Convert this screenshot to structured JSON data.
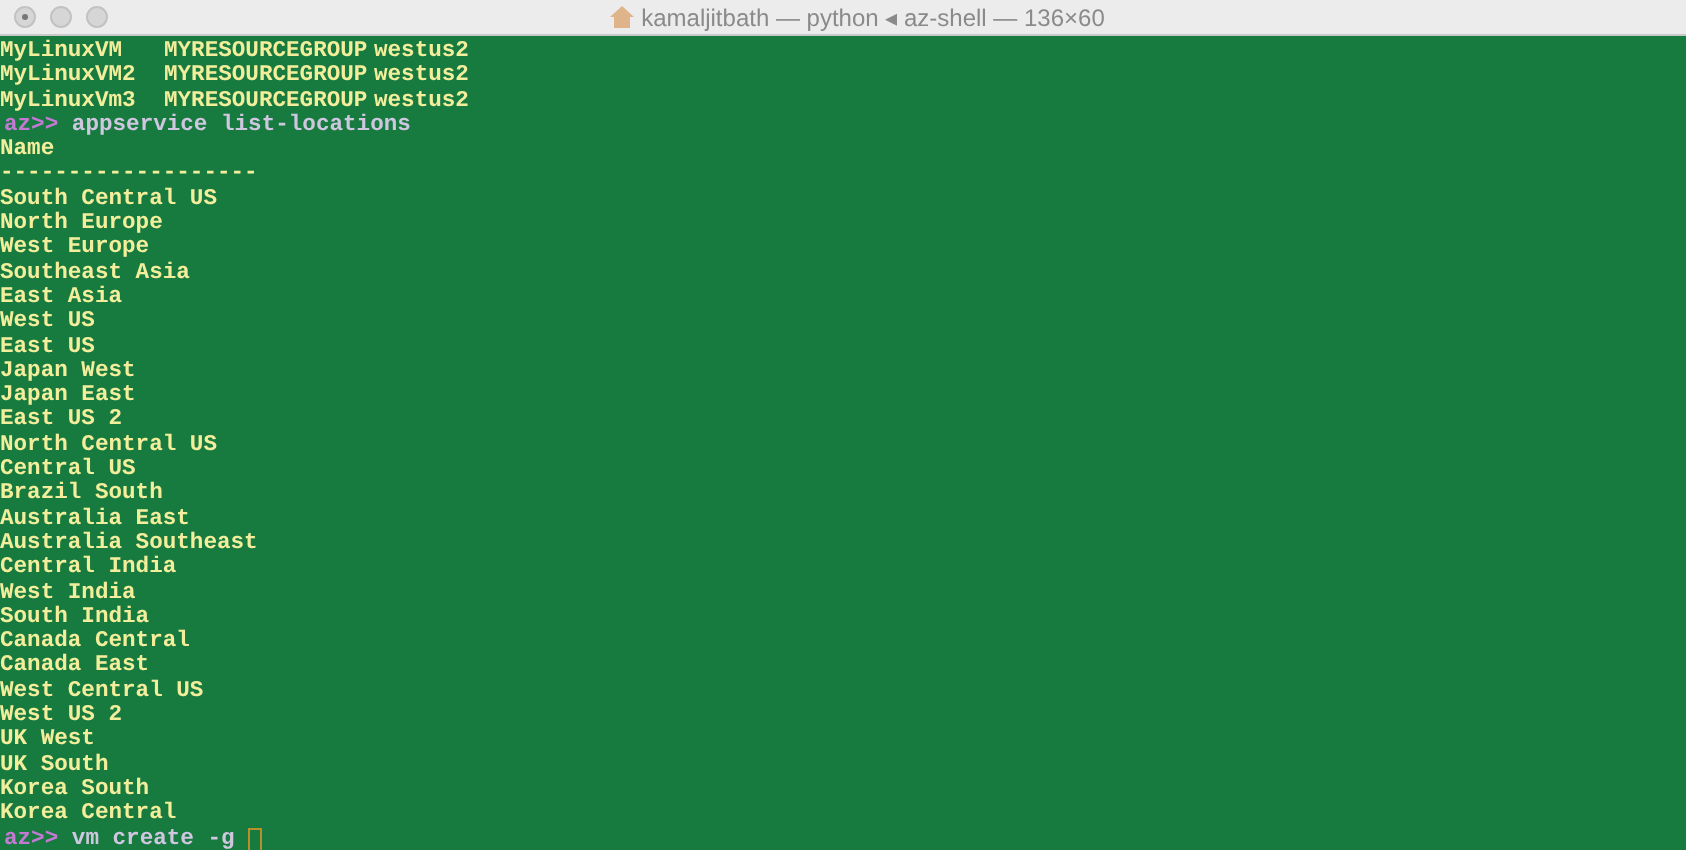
{
  "window": {
    "title": "kamaljitbath — python ◂ az-shell — 136×60"
  },
  "lines": [
    {
      "kind": "row",
      "cells": [
        "MyLinuxVM",
        "MYRESOURCEGROUP",
        "westus2"
      ]
    },
    {
      "kind": "row",
      "cells": [
        "MyLinuxVM2",
        "MYRESOURCEGROUP",
        "westus2"
      ]
    },
    {
      "kind": "row",
      "cells": [
        "MyLinuxVm3",
        "MYRESOURCEGROUP",
        "westus2"
      ]
    },
    {
      "kind": "prompt",
      "prompt": "az>>",
      "command": "appservice list-locations"
    },
    {
      "kind": "output",
      "text": "Name"
    },
    {
      "kind": "output",
      "text": "-------------------"
    },
    {
      "kind": "output",
      "text": "South Central US"
    },
    {
      "kind": "output",
      "text": "North Europe"
    },
    {
      "kind": "output",
      "text": "West Europe"
    },
    {
      "kind": "output",
      "text": "Southeast Asia"
    },
    {
      "kind": "output",
      "text": "East Asia"
    },
    {
      "kind": "output",
      "text": "West US"
    },
    {
      "kind": "output",
      "text": "East US"
    },
    {
      "kind": "output",
      "text": "Japan West"
    },
    {
      "kind": "output",
      "text": "Japan East"
    },
    {
      "kind": "output",
      "text": "East US 2"
    },
    {
      "kind": "output",
      "text": "North Central US"
    },
    {
      "kind": "output",
      "text": "Central US"
    },
    {
      "kind": "output",
      "text": "Brazil South"
    },
    {
      "kind": "output",
      "text": "Australia East"
    },
    {
      "kind": "output",
      "text": "Australia Southeast"
    },
    {
      "kind": "output",
      "text": "Central India"
    },
    {
      "kind": "output",
      "text": "West India"
    },
    {
      "kind": "output",
      "text": "South India"
    },
    {
      "kind": "output",
      "text": "Canada Central"
    },
    {
      "kind": "output",
      "text": "Canada East"
    },
    {
      "kind": "output",
      "text": "West Central US"
    },
    {
      "kind": "output",
      "text": "West US 2"
    },
    {
      "kind": "output",
      "text": "UK West"
    },
    {
      "kind": "output",
      "text": "UK South"
    },
    {
      "kind": "output",
      "text": "Korea South"
    },
    {
      "kind": "output",
      "text": "Korea Central"
    },
    {
      "kind": "prompt",
      "prompt": "az>>",
      "command": "vm create -g",
      "cursor": true
    }
  ]
}
